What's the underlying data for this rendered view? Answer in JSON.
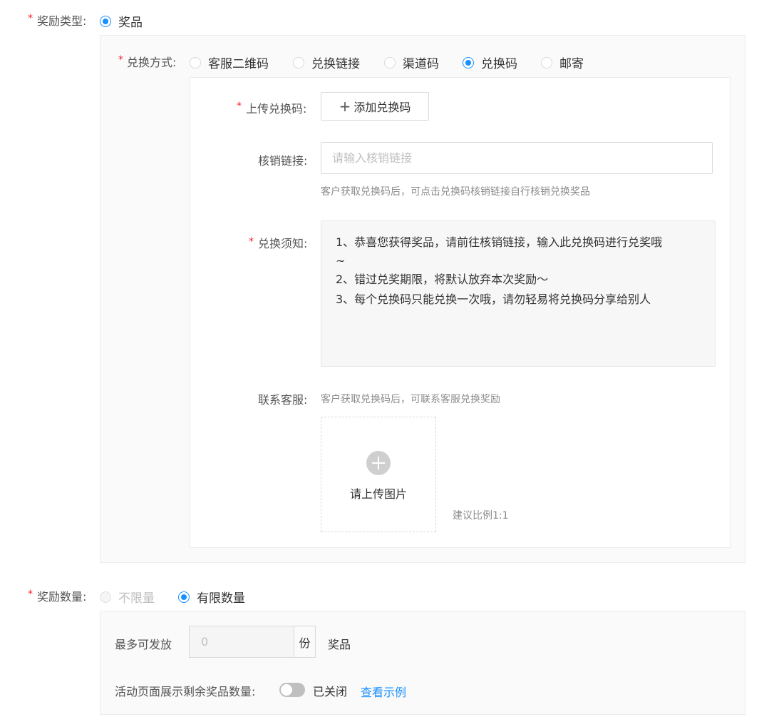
{
  "reward_type": {
    "required": "*",
    "label": "奖励类型:",
    "option_prize": "奖品"
  },
  "exchange_method": {
    "required": "*",
    "label": "兑换方式:",
    "options": [
      "客服二维码",
      "兑换链接",
      "渠道码",
      "兑换码",
      "邮寄"
    ],
    "selected": "兑换码"
  },
  "upload_codes": {
    "required": "*",
    "label": "上传兑换码:",
    "button_label": "添加兑换码"
  },
  "verify_link": {
    "label": "核销链接:",
    "placeholder": "请输入核销链接",
    "value": "",
    "hint": "客户获取兑换码后，可点击兑换码核销链接自行核销兑换奖品"
  },
  "redeem_notice": {
    "required": "*",
    "label": "兑换须知:",
    "line1": "1、恭喜您获得奖品，请前往核销链接，输入此兑换码进行兑奖哦",
    "line1b": "~",
    "line2": "2、错过兑奖期限，将默认放弃本次奖励～",
    "line3": "3、每个兑换码只能兑换一次哦，请勿轻易将兑换码分享给别人"
  },
  "contact_service": {
    "label": "联系客服:",
    "hint": "客户获取兑换码后，可联系客服兑换奖励",
    "upload_text": "请上传图片",
    "ratio_hint": "建议比例1:1"
  },
  "reward_quantity": {
    "required": "*",
    "label": "奖励数量:",
    "option_unlimited": "不限量",
    "option_limited": "有限数量",
    "selected": "有限数量"
  },
  "max_issue": {
    "label": "最多可发放",
    "value": "0",
    "unit": "份",
    "suffix": "奖品"
  },
  "show_remaining": {
    "label": "活动页面展示剩余奖品数量:",
    "state_text": "已关闭",
    "enabled": false,
    "example_link": "查看示例"
  }
}
